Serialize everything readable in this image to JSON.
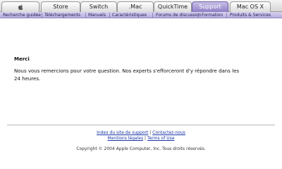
{
  "tabs": [
    {
      "label": "",
      "icon": "apple-logo-icon"
    },
    {
      "label": "Store"
    },
    {
      "label": "Switch"
    },
    {
      "label": ".Mac"
    },
    {
      "label": "QuickTime"
    },
    {
      "label": "Support",
      "active": true
    },
    {
      "label": "Mac OS X"
    }
  ],
  "subnav": [
    "Recherche guidée",
    "Téléchargements",
    "Manuels",
    "Caractéristiques",
    "Forums de discussion",
    "Formation",
    "Produits & Services"
  ],
  "message": {
    "title": "Merci",
    "body": "Nous vous remercions pour votre question. Nos experts s'efforceront d'y répondre dans les 24 heures."
  },
  "footer": {
    "sitemap": "Index du site de support",
    "separator": "|",
    "contact": "Contactez-nous",
    "legal": "Mentions légales",
    "terms": "Terms of Use",
    "copyright": "Copyright © 2004 Apple Computer, Inc. Tous droits réservés."
  },
  "colors": {
    "active_tab": "#8f7fc6",
    "subnav_bg": "#c8c0e8",
    "link": "#1a35a6"
  }
}
